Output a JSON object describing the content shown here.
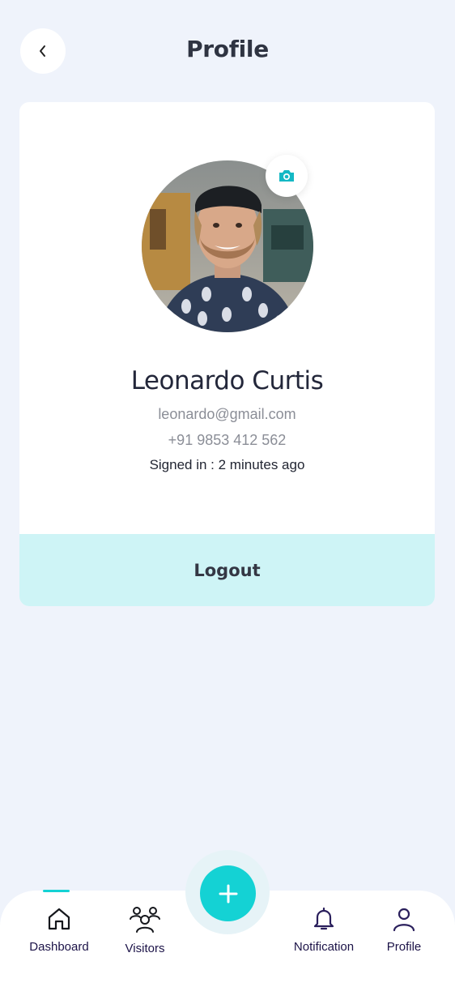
{
  "header": {
    "title": "Profile",
    "back_icon": "chevron-left-icon"
  },
  "profile": {
    "name": "Leonardo Curtis",
    "email": "leonardo@gmail.com",
    "phone": "+91 9853 412 562",
    "signed_in": "Signed in : 2 minutes ago",
    "avatar_alt": "profile-photo",
    "camera_icon": "camera-icon"
  },
  "actions": {
    "logout_label": "Logout"
  },
  "bottom_nav": {
    "active": "Dashboard",
    "items": [
      {
        "label": "Dashboard",
        "icon": "home-icon"
      },
      {
        "label": "Visitors",
        "icon": "users-icon"
      },
      {
        "label": "Notification",
        "icon": "bell-icon"
      },
      {
        "label": "Profile",
        "icon": "user-icon"
      }
    ],
    "fab_icon": "plus-icon"
  },
  "colors": {
    "background": "#eff3fb",
    "accent": "#14d2d4",
    "logout_bg": "#cef4f6",
    "nav_text": "#1c1348"
  }
}
